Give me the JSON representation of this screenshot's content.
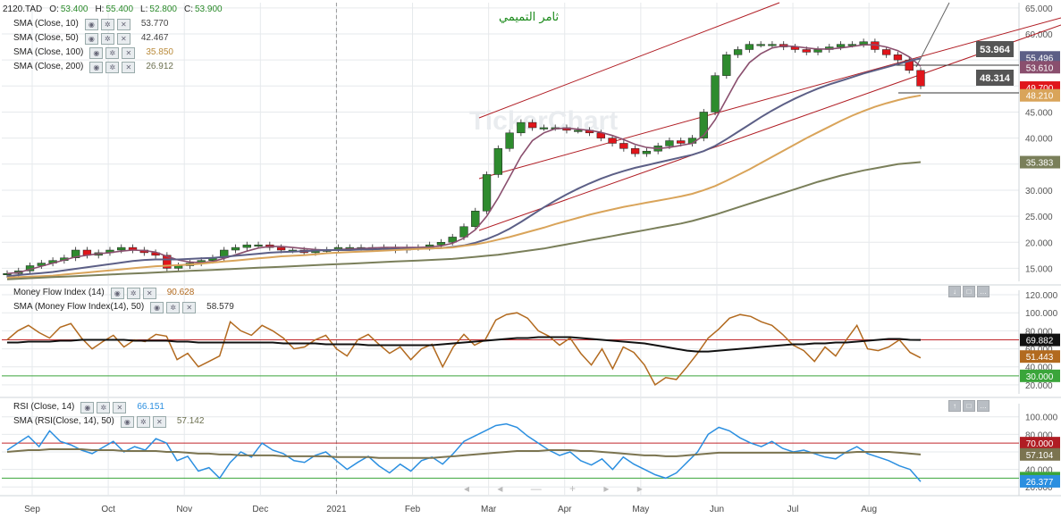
{
  "ticker": "2120.TAD",
  "ohlc": {
    "o_label": "O:",
    "o": "53.400",
    "h_label": "H:",
    "h": "55.400",
    "l_label": "L:",
    "l": "52.800",
    "c_label": "C:",
    "c": "53.900"
  },
  "annotation_text": "ثامر التميمي",
  "icons": {
    "eye": "eye-icon",
    "gear": "gear-icon",
    "close": "close-icon",
    "collapse": "collapse-icon",
    "maximize": "maximize-icon",
    "more": "more-icon",
    "nav_arrows": "navigation-arrows-icon"
  },
  "colors": {
    "up": "#2e8b2e",
    "down": "#e0151b",
    "sma10": "#8a4f6e",
    "sma50": "#5c5f86",
    "sma100": "#d9a45a",
    "sma200": "#7a7f5a",
    "mfi": "#b26a1f",
    "mfi_sma": "#111111",
    "rsi": "#2b8fe0",
    "rsi_sma": "#7b7450",
    "channel": "#b01c23",
    "hline70": "#c0262b",
    "hline30": "#3aa53a",
    "grid": "#e6e9ec"
  },
  "legend_price": [
    {
      "label": "SMA  (Close, 10)",
      "value": "53.770",
      "color": "#444444"
    },
    {
      "label": "SMA  (Close, 50)",
      "value": "42.467",
      "color": "#444444"
    },
    {
      "label": "SMA  (Close, 100)",
      "value": "35.850",
      "color": "#b98a3a"
    },
    {
      "label": "SMA  (Close, 200)",
      "value": "26.912",
      "color": "#6c7050"
    }
  ],
  "legend_mfi": [
    {
      "label": "Money Flow Index  (14)",
      "value": "90.628",
      "color": "#b26a1f"
    },
    {
      "label": "SMA  (Money Flow Index(14), 50)",
      "value": "58.579",
      "color": "#333333"
    }
  ],
  "legend_rsi": [
    {
      "label": "RSI  (Close, 14)",
      "value": "66.151",
      "color": "#2b8fe0"
    },
    {
      "label": "SMA  (RSI(Close, 14), 50)",
      "value": "57.142",
      "color": "#6c7050"
    }
  ],
  "chart_data": [
    {
      "type": "candlestick",
      "title": "2120.TAD",
      "x_ticks": [
        "Sep",
        "Oct",
        "Nov",
        "Dec",
        "2021",
        "Feb",
        "Mar",
        "Apr",
        "May",
        "Jun",
        "Jul",
        "Aug"
      ],
      "y_ticks": [
        "15.000",
        "20.000",
        "25.000",
        "30.000",
        "35.000",
        "40.000",
        "45.000",
        "50.000",
        "55.000",
        "60.000",
        "65.000"
      ],
      "ylim": [
        12.5,
        66
      ],
      "close_path": [
        14,
        14.5,
        15.5,
        16,
        16.5,
        17,
        18.5,
        17.5,
        18,
        18.5,
        19,
        18.5,
        18,
        17.5,
        15,
        15.5,
        16,
        16.5,
        17,
        18.5,
        19,
        19.5,
        19.5,
        19,
        18.5,
        18.5,
        18,
        18.5,
        18.5,
        19,
        19,
        19,
        19,
        19,
        18.5,
        19,
        19,
        19.5,
        20,
        21,
        23,
        26,
        33,
        38,
        41,
        43,
        42,
        42,
        42,
        41.5,
        41.5,
        41,
        40,
        39,
        38,
        37,
        37.5,
        38.5,
        39.5,
        39,
        40,
        45,
        52,
        56,
        57,
        58,
        58,
        58,
        57.5,
        57,
        56.5,
        57,
        57.5,
        58,
        58,
        58.5,
        57,
        56,
        55,
        53,
        50
      ],
      "series": [
        {
          "name": "SMA (Close, 10)",
          "values": [
            14,
            14.2,
            14.8,
            15.4,
            16,
            16.6,
            17.2,
            17.5,
            17.8,
            18,
            18.3,
            18.5,
            18.4,
            18.1,
            17.3,
            16.6,
            16.2,
            16.1,
            16.3,
            16.9,
            17.6,
            18.3,
            18.9,
            19.2,
            19.2,
            19,
            18.8,
            18.6,
            18.5,
            18.6,
            18.7,
            18.8,
            18.9,
            19,
            19,
            19,
            19,
            19.1,
            19.3,
            19.8,
            20.8,
            22.4,
            25,
            28.5,
            32.5,
            36.5,
            39.5,
            41,
            41.8,
            41.9,
            41.7,
            41.5,
            41.1,
            40.5,
            39.7,
            38.8,
            38.2,
            38,
            38.2,
            38.6,
            39,
            40.5,
            43.5,
            47.5,
            51.5,
            54.5,
            56.2,
            57.3,
            57.7,
            57.6,
            57.3,
            57.1,
            57.1,
            57.3,
            57.6,
            57.9,
            57.9,
            57.5,
            56.8,
            55.6,
            53.8
          ]
        },
        {
          "name": "SMA (Close, 50)",
          "values": [
            13.5,
            13.7,
            13.9,
            14.1,
            14.3,
            14.6,
            14.9,
            15.2,
            15.5,
            15.8,
            16.1,
            16.4,
            16.6,
            16.7,
            16.7,
            16.7,
            16.8,
            16.9,
            17,
            17.2,
            17.4,
            17.6,
            17.8,
            18,
            18.1,
            18.2,
            18.3,
            18.4,
            18.5,
            18.5,
            18.5,
            18.6,
            18.6,
            18.7,
            18.7,
            18.7,
            18.8,
            18.8,
            18.9,
            19.1,
            19.4,
            19.9,
            20.6,
            21.5,
            22.6,
            23.9,
            25.3,
            26.7,
            28,
            29.2,
            30.3,
            31.3,
            32.2,
            33,
            33.7,
            34.3,
            34.8,
            35.3,
            35.8,
            36.3,
            36.8,
            37.5,
            38.5,
            39.8,
            41.2,
            42.6,
            44,
            45.3,
            46.5,
            47.6,
            48.6,
            49.5,
            50.3,
            51,
            51.7,
            52.4,
            53,
            53.6,
            54.2,
            54.8,
            55.3
          ]
        },
        {
          "name": "SMA (Close, 100)",
          "values": [
            13.2,
            13.3,
            13.4,
            13.5,
            13.6,
            13.8,
            14,
            14.2,
            14.4,
            14.6,
            14.8,
            15,
            15.2,
            15.4,
            15.5,
            15.6,
            15.7,
            15.9,
            16.1,
            16.3,
            16.5,
            16.7,
            16.9,
            17.1,
            17.3,
            17.4,
            17.5,
            17.7,
            17.9,
            18,
            18.1,
            18.2,
            18.3,
            18.4,
            18.5,
            18.6,
            18.7,
            18.8,
            18.9,
            19,
            19.3,
            19.6,
            20,
            20.5,
            21,
            21.6,
            22.2,
            22.8,
            23.5,
            24.1,
            24.7,
            25.3,
            25.8,
            26.3,
            26.8,
            27.2,
            27.6,
            28,
            28.4,
            28.8,
            29.3,
            30,
            30.8,
            31.8,
            32.9,
            34,
            35.2,
            36.4,
            37.6,
            38.8,
            40,
            41.1,
            42.2,
            43.3,
            44.3,
            45.2,
            46,
            46.7,
            47.3,
            47.8,
            48.2
          ]
        },
        {
          "name": "SMA (Close, 200)",
          "values": [
            12.9,
            13,
            13.1,
            13.2,
            13.3,
            13.4,
            13.5,
            13.6,
            13.7,
            13.8,
            13.9,
            14,
            14.1,
            14.2,
            14.3,
            14.4,
            14.5,
            14.6,
            14.7,
            14.8,
            14.9,
            15,
            15.1,
            15.2,
            15.3,
            15.4,
            15.5,
            15.6,
            15.7,
            15.8,
            15.9,
            16,
            16.1,
            16.2,
            16.3,
            16.4,
            16.5,
            16.6,
            16.7,
            16.8,
            17,
            17.2,
            17.4,
            17.6,
            17.9,
            18.2,
            18.5,
            18.8,
            19.2,
            19.6,
            20,
            20.4,
            20.8,
            21.2,
            21.6,
            22,
            22.4,
            22.8,
            23.2,
            23.6,
            24.1,
            24.7,
            25.3,
            26,
            26.7,
            27.4,
            28.1,
            28.8,
            29.5,
            30.2,
            30.9,
            31.6,
            32.2,
            32.8,
            33.3,
            33.8,
            34.2,
            34.6,
            35,
            35.2,
            35.4
          ]
        }
      ],
      "price_labels": [
        {
          "value": "53.964",
          "bg": "#555555",
          "fg": "#ffffff"
        },
        {
          "value": "48.314",
          "bg": "#555555",
          "fg": "#ffffff"
        }
      ],
      "axis_tags": [
        {
          "value": "55.496",
          "bg": "#5c5f86",
          "fg": "#ffffff"
        },
        {
          "value": "53.610",
          "bg": "#8a4f6e",
          "fg": "#ffffff"
        },
        {
          "value": "49.700",
          "bg": "#e0151b",
          "fg": "#ffffff"
        },
        {
          "value": "48.210",
          "bg": "#d9a45a",
          "fg": "#ffffff"
        },
        {
          "value": "35.383",
          "bg": "#7a7f5a",
          "fg": "#ffffff"
        }
      ]
    },
    {
      "type": "line",
      "title": "Money Flow Index (14)",
      "ylim": [
        10,
        125
      ],
      "y_ticks": [
        "20.000",
        "40.000",
        "60.000",
        "80.000",
        "100.000",
        "120.000"
      ],
      "hlines": [
        70,
        30
      ],
      "series": [
        {
          "name": "Money Flow Index (14)",
          "values": [
            70,
            80,
            86,
            78,
            72,
            84,
            88,
            72,
            60,
            68,
            75,
            62,
            70,
            68,
            76,
            74,
            48,
            55,
            40,
            46,
            52,
            90,
            80,
            75,
            86,
            80,
            72,
            60,
            62,
            70,
            75,
            60,
            52,
            70,
            76,
            65,
            55,
            62,
            48,
            60,
            65,
            40,
            62,
            76,
            64,
            70,
            92,
            98,
            100,
            94,
            80,
            74,
            64,
            72,
            55,
            42,
            60,
            38,
            62,
            56,
            42,
            20,
            28,
            26,
            40,
            55,
            72,
            82,
            94,
            98,
            96,
            90,
            86,
            76,
            64,
            58,
            46,
            62,
            52,
            70,
            86,
            60,
            58,
            62,
            70,
            56,
            50
          ]
        },
        {
          "name": "SMA (Money Flow Index(14), 50)",
          "values": [
            67,
            67,
            68,
            68,
            68,
            69,
            69,
            70,
            70,
            70,
            70,
            70,
            69,
            69,
            69,
            69,
            68,
            68,
            67,
            67,
            67,
            67,
            67,
            67,
            67,
            67,
            66,
            66,
            66,
            66,
            65,
            65,
            65,
            65,
            64,
            64,
            64,
            64,
            64,
            64,
            64,
            65,
            66,
            67,
            68,
            69,
            70,
            71,
            72,
            72,
            73,
            73,
            73,
            73,
            72,
            71,
            70,
            69,
            68,
            67,
            66,
            64,
            62,
            60,
            58,
            57,
            57,
            58,
            59,
            60,
            61,
            62,
            63,
            64,
            65,
            65,
            66,
            66,
            67,
            67,
            68,
            69,
            70,
            71,
            71,
            70,
            69.9
          ]
        }
      ],
      "axis_tags": [
        {
          "value": "69.882",
          "bg": "#111111",
          "fg": "#ffffff"
        },
        {
          "value": "51.443",
          "bg": "#b26a1f",
          "fg": "#ffffff"
        },
        {
          "value": "30.000",
          "bg": "#3aa53a",
          "fg": "#ffffff"
        }
      ]
    },
    {
      "type": "line",
      "title": "RSI (Close, 14)",
      "ylim": [
        10,
        115
      ],
      "y_ticks": [
        "20.000",
        "40.000",
        "60.000",
        "80.000",
        "100.000"
      ],
      "hlines": [
        70,
        30
      ],
      "series": [
        {
          "name": "RSI (Close, 14)",
          "values": [
            62,
            70,
            78,
            66,
            84,
            72,
            68,
            62,
            58,
            65,
            72,
            60,
            66,
            62,
            75,
            70,
            50,
            55,
            38,
            42,
            30,
            48,
            60,
            54,
            70,
            62,
            58,
            50,
            48,
            56,
            60,
            50,
            40,
            48,
            55,
            44,
            36,
            46,
            38,
            50,
            54,
            46,
            58,
            72,
            78,
            84,
            90,
            92,
            88,
            78,
            70,
            62,
            56,
            60,
            50,
            45,
            52,
            40,
            54,
            46,
            40,
            34,
            30,
            36,
            48,
            60,
            80,
            88,
            84,
            76,
            70,
            66,
            72,
            64,
            60,
            62,
            58,
            54,
            52,
            60,
            66,
            58,
            54,
            50,
            44,
            40,
            26
          ]
        },
        {
          "name": "SMA (RSI(Close, 14), 50)",
          "values": [
            60,
            61,
            62,
            62,
            63,
            63,
            63,
            63,
            62,
            62,
            62,
            61,
            61,
            61,
            61,
            60,
            60,
            59,
            58,
            58,
            57,
            57,
            56,
            56,
            56,
            56,
            55,
            55,
            55,
            55,
            55,
            54,
            54,
            54,
            54,
            53,
            53,
            53,
            53,
            53,
            53,
            54,
            55,
            56,
            57,
            58,
            59,
            60,
            61,
            61,
            61,
            62,
            62,
            62,
            61,
            61,
            60,
            59,
            58,
            57,
            56,
            56,
            55,
            55,
            56,
            57,
            58,
            59,
            59,
            59,
            59,
            59,
            59,
            59,
            59,
            59,
            59,
            59,
            59,
            59,
            60,
            60,
            60,
            60,
            59,
            58,
            57
          ]
        }
      ],
      "axis_tags": [
        {
          "value": "70.000",
          "bg": "#b01c23",
          "fg": "#ffffff"
        },
        {
          "value": "57.104",
          "bg": "#7b7450",
          "fg": "#ffffff"
        },
        {
          "value": "30.000",
          "bg": "#3aa53a",
          "fg": "#ffffff"
        },
        {
          "value": "26.377",
          "bg": "#2b8fe0",
          "fg": "#ffffff"
        }
      ]
    }
  ]
}
